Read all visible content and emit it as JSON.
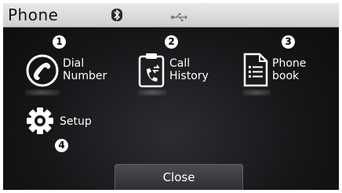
{
  "header": {
    "title": "Phone"
  },
  "icons": {
    "bluetooth": "bluetooth-icon",
    "usb": "usb-icon"
  },
  "menu": {
    "dial": {
      "label": "Dial\nNumber",
      "callout": "1"
    },
    "history": {
      "label": "Call\nHistory",
      "callout": "2"
    },
    "phonebook": {
      "label": "Phone\nbook",
      "callout": "3"
    },
    "setup": {
      "label": "Setup",
      "callout": "4"
    }
  },
  "footer": {
    "close_label": "Close"
  },
  "colors": {
    "background": "#151618",
    "titlebar": "#d9d9d9",
    "text": "#ffffff"
  }
}
